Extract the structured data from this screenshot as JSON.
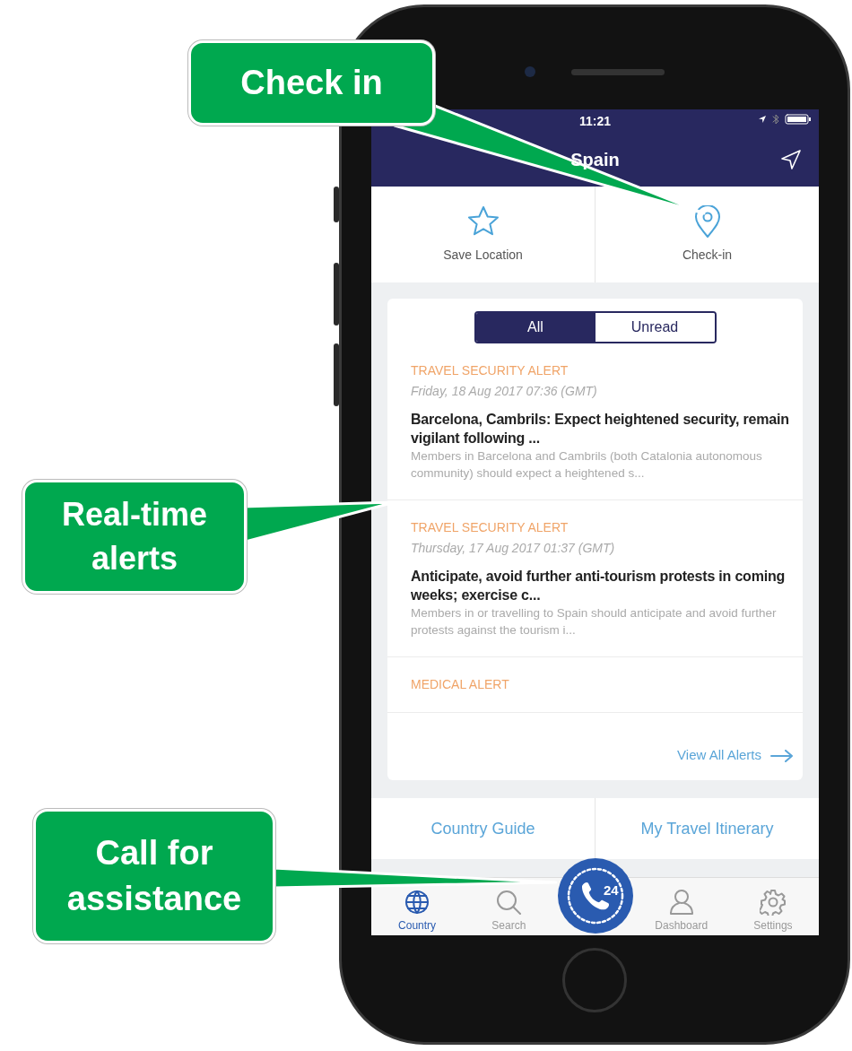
{
  "status_bar": {
    "time": "11:21"
  },
  "header": {
    "title": "Spain"
  },
  "actions": [
    {
      "label": "Save Location",
      "kind": "star"
    },
    {
      "label": "Check-in",
      "kind": "pin"
    }
  ],
  "filter_tabs": [
    {
      "label": "All",
      "selected": true
    },
    {
      "label": "Unread",
      "selected": false
    }
  ],
  "alerts": [
    {
      "category": "TRAVEL SECURITY ALERT",
      "date": "Friday, 18 Aug 2017 07:36 (GMT)",
      "title": "Barcelona, Cambrils: Expect heightened security, remain vigilant following ...",
      "summary": "Members in Barcelona and Cambrils (both Catalonia autonomous community) should expect a heightened s..."
    },
    {
      "category": "TRAVEL SECURITY ALERT",
      "date": "Thursday, 17 Aug 2017 01:37 (GMT)",
      "title": "Anticipate, avoid further anti-tourism protests in coming weeks; exercise c...",
      "summary": "Members in or travelling to Spain should anticipate and avoid further protests against the tourism i..."
    },
    {
      "category": "MEDICAL ALERT"
    }
  ],
  "view_all": "View All Alerts",
  "links": [
    "Country Guide",
    "My Travel Itinerary"
  ],
  "tab_bar": [
    {
      "label": "Country",
      "kind": "globe",
      "selected": true
    },
    {
      "label": "Search",
      "kind": "search",
      "selected": false
    },
    {
      "kind": "call",
      "label": "24"
    },
    {
      "label": "Dashboard",
      "kind": "person",
      "selected": false
    },
    {
      "label": "Settings",
      "kind": "gear",
      "selected": false
    }
  ],
  "callouts": [
    {
      "text": "Check in"
    },
    {
      "text": "Real-time alerts"
    },
    {
      "text": "Call for assistance"
    }
  ]
}
